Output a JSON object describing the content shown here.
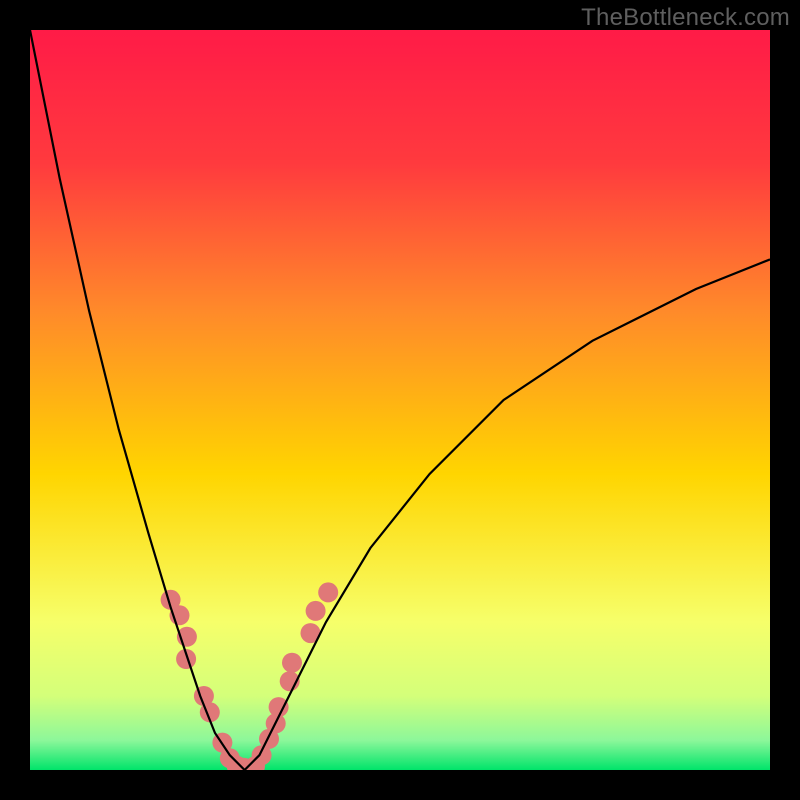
{
  "watermark": "TheBottleneck.com",
  "chart_data": {
    "type": "line",
    "title": "",
    "xlabel": "",
    "ylabel": "",
    "xlim": [
      0,
      100
    ],
    "ylim": [
      0,
      100
    ],
    "grid": false,
    "legend": false,
    "background_gradient_top": "#ff1b47",
    "background_gradient_mid": "#ffd500",
    "background_gradient_bottom": "#00e46a",
    "series": [
      {
        "name": "bottleneck-curve",
        "color": "#000000",
        "x": [
          0,
          4,
          8,
          12,
          16,
          19,
          21,
          23,
          25,
          27,
          29,
          31,
          33,
          36,
          40,
          46,
          54,
          64,
          76,
          90,
          100
        ],
        "y": [
          100,
          80,
          62,
          46,
          32,
          22,
          16,
          10,
          5,
          2,
          0,
          2,
          6,
          12,
          20,
          30,
          40,
          50,
          58,
          65,
          69
        ]
      }
    ],
    "markers": {
      "name": "highlight-dots",
      "color": "#e07878",
      "radius": 10,
      "x": [
        19.0,
        20.2,
        21.2,
        21.1,
        23.5,
        24.3,
        26.0,
        27.0,
        27.9,
        28.9,
        30.4,
        31.3,
        32.3,
        33.2,
        33.6,
        35.1,
        35.4,
        37.9,
        38.6,
        40.3
      ],
      "y": [
        23.0,
        20.9,
        18.0,
        15.0,
        10.0,
        7.8,
        3.7,
        1.6,
        0.6,
        0.3,
        0.5,
        2.0,
        4.2,
        6.3,
        8.5,
        12.0,
        14.5,
        18.5,
        21.5,
        24.0
      ]
    }
  }
}
